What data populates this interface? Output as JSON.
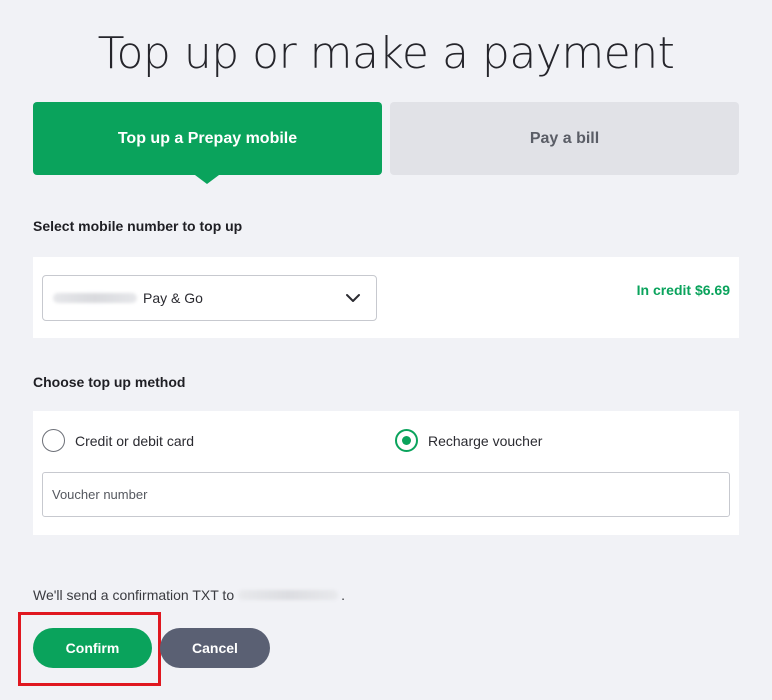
{
  "page": {
    "title": "Top up or make a payment"
  },
  "tabs": [
    {
      "label": "Top up a Prepay mobile",
      "active": true
    },
    {
      "label": "Pay a bill",
      "active": false
    }
  ],
  "mobile_section": {
    "label": "Select mobile number to top up",
    "select_value": "Pay & Go",
    "credit_text": "In credit $6.69"
  },
  "method_section": {
    "label": "Choose top up method",
    "options": [
      {
        "label": "Credit or debit card",
        "selected": false
      },
      {
        "label": "Recharge voucher",
        "selected": true
      }
    ],
    "voucher_placeholder": "Voucher number",
    "voucher_value": ""
  },
  "confirmation": {
    "prefix": "We'll send a confirmation TXT to",
    "suffix": "."
  },
  "actions": {
    "confirm_label": "Confirm",
    "cancel_label": "Cancel"
  },
  "colors": {
    "brand_green": "#0aa35c",
    "cancel_gray": "#5a6073",
    "highlight_red": "#e0171f",
    "background": "#f1f2f6"
  }
}
